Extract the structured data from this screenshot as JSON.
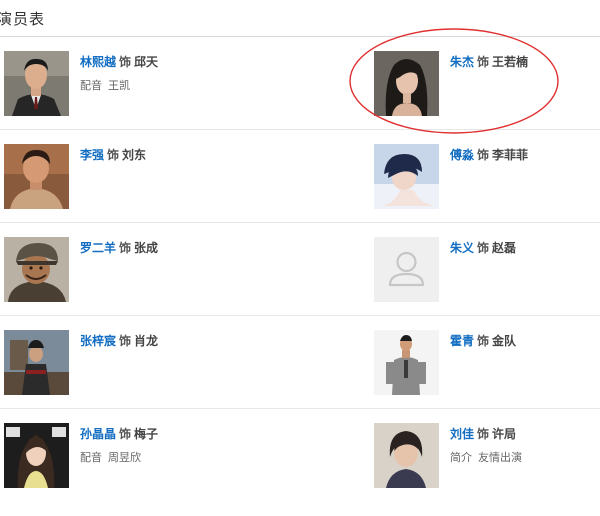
{
  "section": {
    "title": "演员表"
  },
  "cast": [
    {
      "actor": "林熙越",
      "sep": "饰",
      "role": "邱天",
      "sub_label": "配音",
      "sub_value": "王凯",
      "photo_icon": "actor-portrait-man-suit"
    },
    {
      "actor": "朱杰",
      "sep": "饰",
      "role": "王若楠",
      "sub_label": "",
      "sub_value": "",
      "photo_icon": "actor-portrait-woman"
    },
    {
      "actor": "李强",
      "sep": "饰",
      "role": "刘东",
      "sub_label": "",
      "sub_value": "",
      "photo_icon": "actor-portrait-man"
    },
    {
      "actor": "傅淼",
      "sep": "饰",
      "role": "李菲菲",
      "sub_label": "",
      "sub_value": "",
      "photo_icon": "actor-portrait-woman-short-hair"
    },
    {
      "actor": "罗二羊",
      "sep": "饰",
      "role": "张成",
      "sub_label": "",
      "sub_value": "",
      "photo_icon": "actor-portrait-man-costume"
    },
    {
      "actor": "朱义",
      "sep": "饰",
      "role": "赵磊",
      "sub_label": "",
      "sub_value": "",
      "photo_icon": "user-placeholder-icon"
    },
    {
      "actor": "张梓宸",
      "sep": "饰",
      "role": "肖龙",
      "sub_label": "",
      "sub_value": "",
      "photo_icon": "actor-portrait-man-outdoor"
    },
    {
      "actor": "霍青",
      "sep": "饰",
      "role": "金队",
      "sub_label": "",
      "sub_value": "",
      "photo_icon": "actor-portrait-man-standing"
    },
    {
      "actor": "孙晶晶",
      "sep": "饰",
      "role": "梅子",
      "sub_label": "配音",
      "sub_value": "周昱欣",
      "photo_icon": "actor-portrait-woman-long-hair"
    },
    {
      "actor": "刘佳",
      "sep": "饰",
      "role": "许局",
      "sub_label": "简介",
      "sub_value": "友情出演",
      "photo_icon": "actor-portrait-woman-older"
    }
  ],
  "colors": {
    "link": "#136ec2",
    "highlight": "#e03030",
    "divider": "#e8e8e8"
  }
}
